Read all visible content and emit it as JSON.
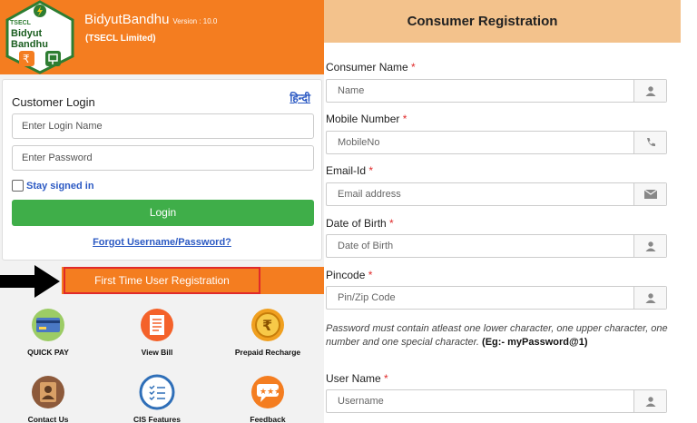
{
  "app": {
    "name": "BidyutBandhu",
    "version": "Version : 10.0",
    "org": "(TSECL Limited)",
    "logo_lines": [
      "TSECL",
      "Bidyut",
      "Bandhu"
    ]
  },
  "login": {
    "title": "Customer Login",
    "hindi_link": "हिन्दी",
    "username_placeholder": "Enter Login Name",
    "password_placeholder": "Enter Password",
    "stay_signed_in": "Stay signed in",
    "login_button": "Login",
    "forgot_link": "Forgot Username/Password?"
  },
  "registration_banner": "First Time User Registration",
  "tiles": [
    {
      "label": "QUICK PAY",
      "icon": "card-payment-icon"
    },
    {
      "label": "View Bill",
      "icon": "bill-icon"
    },
    {
      "label": "Prepaid Recharge",
      "icon": "rupee-coin-icon"
    },
    {
      "label": "Contact Us",
      "icon": "contact-book-icon"
    },
    {
      "label": "CIS Features",
      "icon": "checklist-icon"
    },
    {
      "label": "Feedback",
      "icon": "feedback-bubble-icon"
    }
  ],
  "form": {
    "title": "Consumer Registration",
    "fields": [
      {
        "label": "Consumer Name",
        "required": "*",
        "placeholder": "Name",
        "icon": "user-icon"
      },
      {
        "label": "Mobile Number",
        "required": "*",
        "placeholder": "MobileNo",
        "icon": "phone-icon"
      },
      {
        "label": "Email-Id",
        "required": "*",
        "placeholder": "Email address",
        "icon": "envelope-icon"
      },
      {
        "label": "Date of Birth",
        "required": "*",
        "placeholder": "Date of Birth",
        "icon": "user-icon"
      },
      {
        "label": "Pincode",
        "required": "*",
        "placeholder": "Pin/Zip Code",
        "icon": "user-icon"
      },
      {
        "label": "User Name",
        "required": "*",
        "placeholder": "Username",
        "icon": "user-icon"
      }
    ],
    "password_note": "Password must contain atleast one lower character, one upper character, one number and one special character.",
    "password_example": "(Eg:- myPassword@1)"
  },
  "colors": {
    "brand_orange": "#f47d20",
    "login_green": "#3fae49",
    "link_blue": "#2b59c3",
    "highlight_red": "#e02a2a",
    "form_header": "#f3c28c"
  }
}
